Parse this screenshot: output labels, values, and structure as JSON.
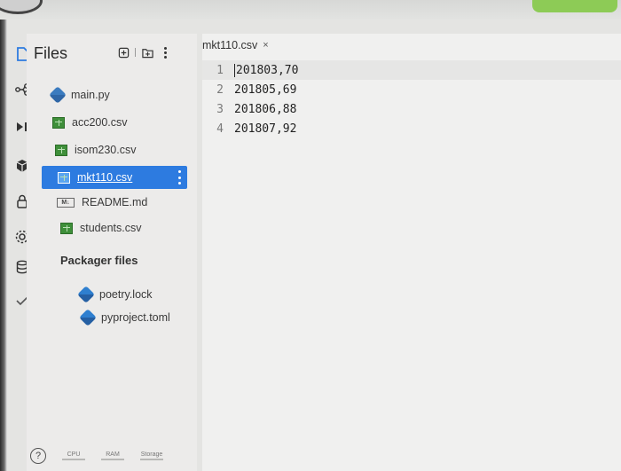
{
  "sidebar": {
    "title": "Files",
    "files": [
      {
        "name": "main.py",
        "type": "python"
      },
      {
        "name": "acc200.csv",
        "type": "csv"
      },
      {
        "name": "isom230.csv",
        "type": "csv"
      },
      {
        "name": "mkt110.csv",
        "type": "csv",
        "selected": true
      },
      {
        "name": "README.md",
        "type": "markdown"
      },
      {
        "name": "students.csv",
        "type": "csv"
      }
    ],
    "packager_label": "Packager files",
    "packager_files": [
      {
        "name": "poetry.lock",
        "type": "config"
      },
      {
        "name": "pyproject.toml",
        "type": "config"
      }
    ],
    "md_badge": "M↓"
  },
  "status": {
    "help": "?",
    "cpu": "CPU",
    "ram": "RAM",
    "storage": "Storage"
  },
  "editor": {
    "tab_label": "mkt110.csv",
    "tab_close": "×",
    "lines": [
      {
        "num": "1",
        "text": "201803,70"
      },
      {
        "num": "2",
        "text": "201805,69"
      },
      {
        "num": "3",
        "text": "201806,88"
      },
      {
        "num": "4",
        "text": "201807,92"
      }
    ]
  },
  "colors": {
    "selection": "#2d7be0",
    "csv_icon": "#3f8f3a",
    "python_icon": "#3b7bbf"
  }
}
